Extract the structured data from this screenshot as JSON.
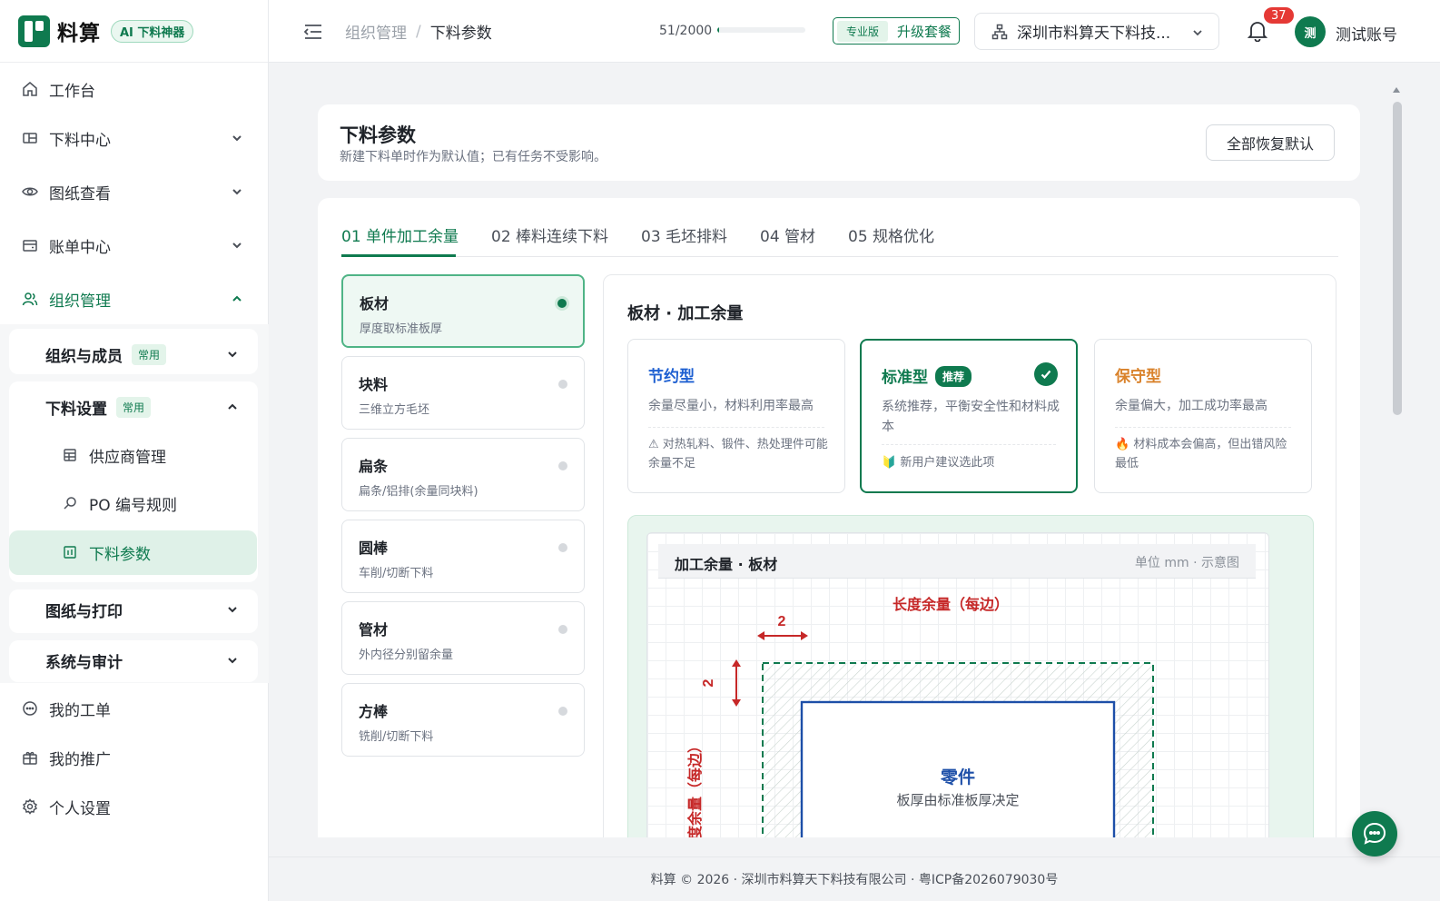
{
  "brand": {
    "name": "料算",
    "ai_badge": "AI 下料神器",
    "accent": "#0f7a4f"
  },
  "sidebar": {
    "items": [
      {
        "label": "工作台",
        "icon": "home-icon"
      },
      {
        "label": "下料中心",
        "icon": "layout-icon"
      },
      {
        "label": "图纸查看",
        "icon": "eye-icon"
      },
      {
        "label": "账单中心",
        "icon": "wallet-icon"
      },
      {
        "label": "组织管理",
        "icon": "users-icon"
      }
    ],
    "org_children": {
      "members": {
        "label": "组织与成员",
        "tag": "常用"
      },
      "settings": {
        "label": "下料设置",
        "tag": "常用",
        "leaves": [
          {
            "label": "供应商管理",
            "icon": "table-icon"
          },
          {
            "label": "PO 编号规则",
            "icon": "search-icon"
          },
          {
            "label": "下料参数",
            "icon": "grid-icon"
          }
        ]
      },
      "print": {
        "label": "图纸与打印"
      },
      "audit": {
        "label": "系统与审计"
      }
    },
    "bottom": [
      {
        "label": "我的工单",
        "icon": "chat-icon"
      },
      {
        "label": "我的推广",
        "icon": "gift-icon"
      },
      {
        "label": "个人设置",
        "icon": "gear-icon"
      }
    ]
  },
  "header": {
    "breadcrumb": [
      "组织管理",
      "下料参数"
    ],
    "quota_text": "51/2000",
    "quota_fraction": 0.0255,
    "plan_badge": "专业版",
    "upgrade_label": "升级套餐",
    "company": "深圳市料算天下料技...",
    "notifications": "37",
    "avatar_text": "测",
    "username": "测试账号"
  },
  "page": {
    "title": "下料参数",
    "desc": "新建下料单时作为默认值；已有任务不受影响。",
    "reset_label": "全部恢复默认"
  },
  "tabs": [
    "01 单件加工余量",
    "02 棒料连续下料",
    "03 毛坯排料",
    "04 管材",
    "05 规格优化"
  ],
  "materials": [
    {
      "name": "板材",
      "sub": "厚度取标准板厚"
    },
    {
      "name": "块料",
      "sub": "三维立方毛坯"
    },
    {
      "name": "扁条",
      "sub": "扁条/铝排(余量同块料)"
    },
    {
      "name": "圆棒",
      "sub": "车削/切断下料"
    },
    {
      "name": "管材",
      "sub": "外内径分别留余量"
    },
    {
      "name": "方棒",
      "sub": "铣削/切断下料"
    }
  ],
  "panel": {
    "title": "板材 · 加工余量",
    "options": [
      {
        "name": "节约型",
        "color": "#1d5fd1",
        "desc": "余量尽量小，材料利用率最高",
        "note": "⚠ 对热轧料、锻件、热处理件可能余量不足"
      },
      {
        "name": "标准型",
        "color": "#0f7a4f",
        "tag": "推荐",
        "desc": "系统推荐，平衡安全性和材料成本",
        "note": "🔰 新用户建议选此项"
      },
      {
        "name": "保守型",
        "color": "#d9822b",
        "desc": "余量偏大，加工成功率最高",
        "note": "🔥 材料成本会偏高，但出错风险最低"
      }
    ],
    "diagram": {
      "title": "加工余量 · 板材",
      "unit": "单位 mm · 示意图",
      "length_label": "长度余量（每边）",
      "width_label": "宽度余量（每边）",
      "h_value": "2",
      "v_value": "2",
      "part_label": "零件",
      "part_sub": "板厚由标准板厚决定"
    }
  },
  "footer": "料算 © 2026 · 深圳市料算天下料技有限公司 · 粤ICP备2026079030号"
}
